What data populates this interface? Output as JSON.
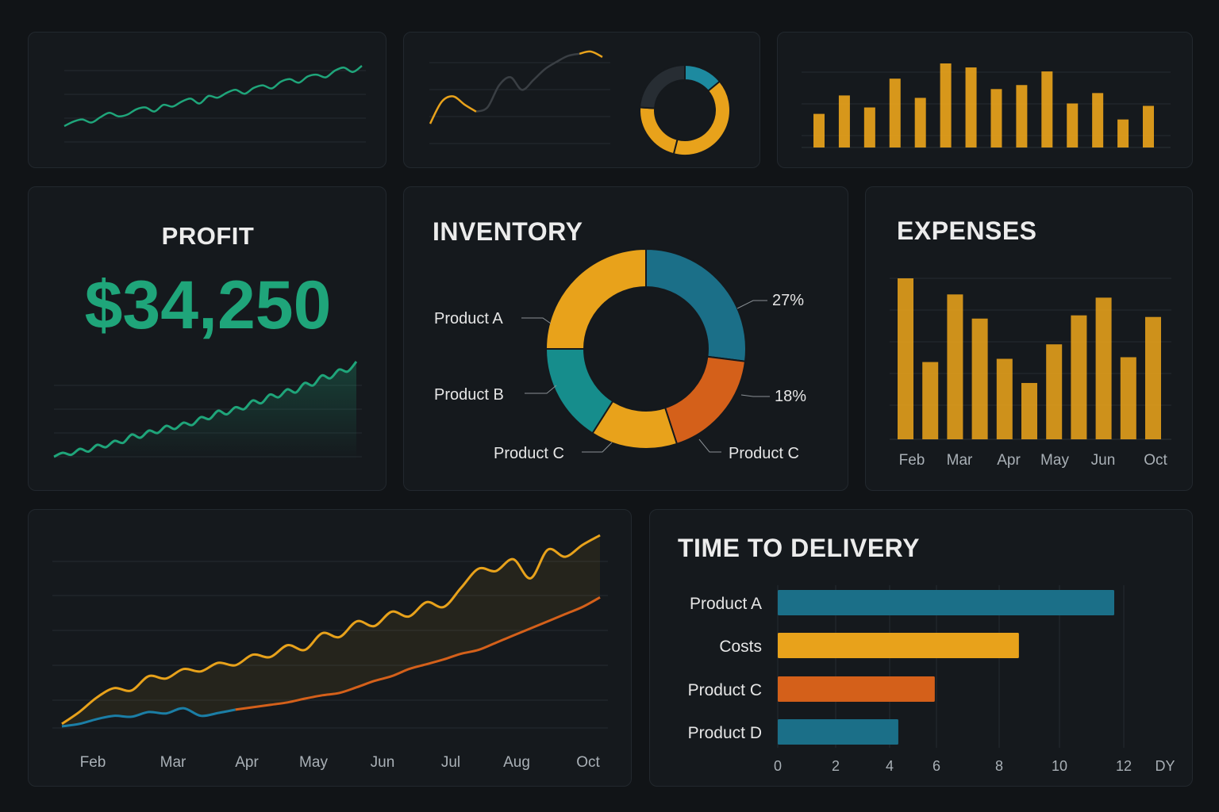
{
  "colors": {
    "green": "#1fa57a",
    "yellow": "#e8a21b",
    "teal": "#1d8aa0",
    "orange": "#d4601a",
    "blue": "#1b7ea6",
    "grid": "#252b31"
  },
  "profit": {
    "title": "PROFIT",
    "value": "$34,250"
  },
  "inventory": {
    "title": "INVENTORY"
  },
  "expenses": {
    "title": "EXPENSES"
  },
  "delivery": {
    "title": "TIME TO DELIVERY"
  },
  "chart_data": [
    {
      "id": "spark-green",
      "type": "line",
      "values": [
        2,
        3,
        3.5,
        2.8,
        4,
        5,
        4.2,
        4.6,
        5.8,
        6.2,
        5.3,
        6.8,
        6.4,
        7.5,
        8.2,
        7.1,
        8.8,
        8.4,
        9.5,
        10.2,
        9.3,
        10.6,
        11.2,
        10.5,
        12,
        12.6,
        11.8,
        13.2,
        13.6,
        13,
        14.5,
        15.2,
        14.2,
        15.6
      ]
    },
    {
      "id": "mini-line",
      "type": "line",
      "values": [
        1,
        5,
        6,
        4.5,
        3.2,
        4,
        8,
        9.5,
        7.2,
        9,
        11,
        12.3,
        13.4,
        13.8,
        14.2,
        13.2
      ],
      "yellow_until": 4,
      "accent_from": 13
    },
    {
      "id": "mini-donut",
      "type": "pie",
      "values": [
        14,
        40,
        22,
        24
      ],
      "colors": [
        "#1d8aa0",
        "#e8a21b",
        "#e8a21b",
        "#272d33"
      ]
    },
    {
      "id": "mini-bars",
      "type": "bar",
      "values": [
        42,
        65,
        50,
        86,
        62,
        105,
        100,
        73,
        78,
        95,
        55,
        68,
        35,
        52
      ]
    },
    {
      "id": "profit-trend",
      "type": "area",
      "values": [
        1,
        2,
        1.5,
        3,
        2.3,
        4,
        3.4,
        5,
        4.5,
        6.6,
        5.8,
        7.6,
        7,
        8.8,
        8,
        9.6,
        9,
        11,
        10.5,
        12.6,
        11.7,
        13.5,
        13,
        15.2,
        14.5,
        16.7,
        16,
        18,
        17.2,
        19.6,
        19,
        21.5,
        20.8,
        23,
        22.5,
        25
      ]
    },
    {
      "id": "inventory-donut",
      "type": "pie",
      "slices": [
        {
          "label": "27%",
          "value": 27,
          "color": "#1b6f88"
        },
        {
          "label": "Product C",
          "value": 18,
          "color": "#d4601a"
        },
        {
          "label": "Product C",
          "value": 14,
          "color": "#e8a21b"
        },
        {
          "label": "Product B",
          "value": 16,
          "color": "#168d8c"
        },
        {
          "label": "Product A",
          "value": 25,
          "color": "#e8a21b"
        }
      ],
      "labels": {
        "product_a": "Product A",
        "product_b": "Product B",
        "product_c_left": "Product C",
        "product_c_right": "Product C",
        "pct_27": "27%",
        "pct_18": "18%"
      }
    },
    {
      "id": "expenses-bars",
      "type": "bar",
      "values": [
        100,
        48,
        90,
        75,
        50,
        35,
        59,
        77,
        88,
        51,
        76
      ],
      "tick_labels": [
        "Feb",
        "Mar",
        "Apr",
        "May",
        "Jun",
        "Oct"
      ],
      "ylim": [
        0,
        100
      ]
    },
    {
      "id": "trend-lines",
      "type": "line",
      "x_labels": [
        "Feb",
        "Mar",
        "Apr",
        "May",
        "Jun",
        "Jul",
        "Aug",
        "Oct"
      ],
      "series": [
        {
          "values": [
            0.5,
            3,
            6,
            8,
            7.5,
            10.5,
            10,
            12,
            11.5,
            13.3,
            12.8,
            15,
            14.5,
            17,
            16,
            19.5,
            18.7,
            22,
            21,
            24,
            23,
            26,
            25,
            29,
            33,
            32.5,
            35,
            31,
            37,
            35.5,
            38,
            40
          ]
        },
        {
          "values": [
            0,
            0.5,
            1.5,
            2.2,
            2,
            3,
            2.7,
            3.8,
            2.2,
            2.8,
            3.5,
            4,
            4.5,
            5,
            5.8,
            6.5,
            7,
            8.2,
            9.5,
            10.5,
            12,
            13,
            14,
            15.2,
            16,
            17.5,
            19,
            20.5,
            22,
            23.5,
            25,
            27
          ],
          "split_at": 10
        }
      ],
      "ylim": [
        -2,
        42
      ]
    },
    {
      "id": "delivery-bars",
      "type": "bar",
      "orientation": "horizontal",
      "categories": [
        "Product A",
        "Costs",
        "Product C",
        "Product D"
      ],
      "values": [
        12,
        8.6,
        5.6,
        4.3
      ],
      "colors": [
        "#1b6f88",
        "#e8a21b",
        "#d4601a",
        "#1b6f88"
      ],
      "x_ticks": [
        "0",
        "2",
        "4",
        "6",
        "8",
        "10",
        "12"
      ],
      "x_tick_values": [
        0,
        2,
        4,
        6,
        8,
        10,
        12
      ],
      "x_unit": "DY",
      "xlim": [
        0,
        14
      ]
    }
  ]
}
